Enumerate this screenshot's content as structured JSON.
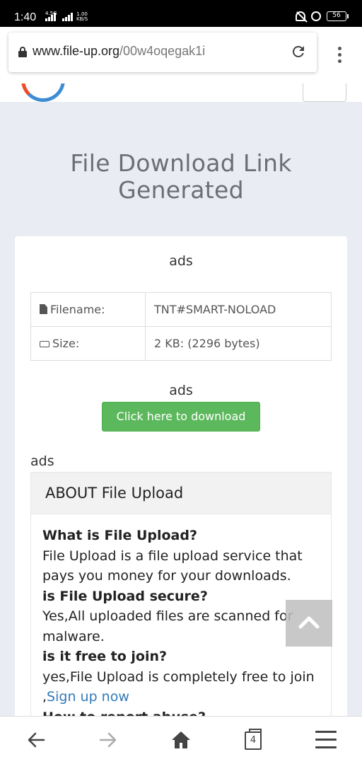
{
  "status_bar": {
    "time": "1:40",
    "network_type": "4.5G",
    "speed_value": "1.00",
    "speed_unit": "KB/S",
    "battery": "56"
  },
  "browser": {
    "url_host": "www.file-up.org",
    "url_path": "/00w4oqegak1i",
    "tab_count": "4"
  },
  "page": {
    "title_line1": "File Download Link",
    "title_line2": "Generated",
    "ads_label": "ads",
    "file_table": {
      "filename_label": "Filename:",
      "filename_value": "TNT#SMART-NOLOAD",
      "size_label": "Size:",
      "size_value": "2 KB: (2296 bytes)"
    },
    "download_button": "Click here to download",
    "about": {
      "heading": "ABOUT File Upload",
      "q1": "What is File Upload?",
      "a1": "File Upload is a file upload service that pays you money for your downloads.",
      "q2": "is File Upload secure?",
      "a2": "Yes,All uploaded files are scanned for malware.",
      "q3": "is it free to join?",
      "a3": "yes,File Upload is completely free to join",
      "a3_link_prefix": ",",
      "a3_link": "Sign up now",
      "q4": "How to report abuse?"
    }
  },
  "colors": {
    "accent_green": "#5cb85c",
    "link_blue": "#337ab7",
    "page_background": "#e9ecf3"
  },
  "icons": [
    "reload-icon",
    "lock-icon",
    "file-icon",
    "hdd-icon",
    "chevron-up-icon",
    "back-arrow-icon",
    "forward-arrow-icon",
    "home-icon",
    "tabs-icon",
    "menu-icon"
  ]
}
